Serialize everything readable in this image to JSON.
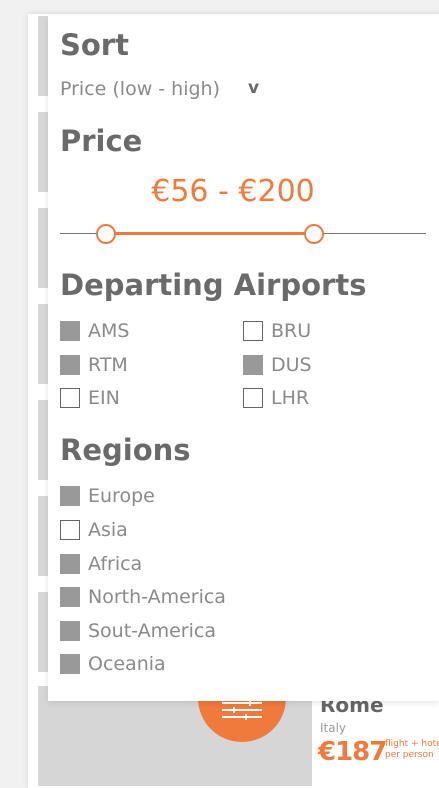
{
  "sort": {
    "heading": "Sort",
    "value": "Price (low - high)",
    "caret": "v"
  },
  "price": {
    "heading": "Price",
    "range_text": "€56 - €200",
    "min": 56,
    "max": 200
  },
  "airports": {
    "heading": "Departing Airports",
    "items": [
      {
        "label": "AMS",
        "checked": true
      },
      {
        "label": "BRU",
        "checked": false
      },
      {
        "label": "RTM",
        "checked": true
      },
      {
        "label": "DUS",
        "checked": true
      },
      {
        "label": "EIN",
        "checked": false
      },
      {
        "label": "LHR",
        "checked": false
      }
    ]
  },
  "regions": {
    "heading": "Regions",
    "items": [
      {
        "label": "Europe",
        "checked": true
      },
      {
        "label": "Asia",
        "checked": false
      },
      {
        "label": "Africa",
        "checked": true
      },
      {
        "label": "North-America",
        "checked": true
      },
      {
        "label": "Sout-America",
        "checked": true
      },
      {
        "label": "Oceania",
        "checked": true
      }
    ]
  },
  "result_card": {
    "title": "Rome",
    "country": "Italy",
    "price": "€187",
    "note_line1": "flight + hotel",
    "note_line2": "per person"
  },
  "filter_button": {
    "icon": "filter-sliders-icon"
  },
  "colors": {
    "accent": "#f07a3c",
    "checked": "#999999",
    "text": "#8a8a8a",
    "heading": "#6a6a6a"
  }
}
